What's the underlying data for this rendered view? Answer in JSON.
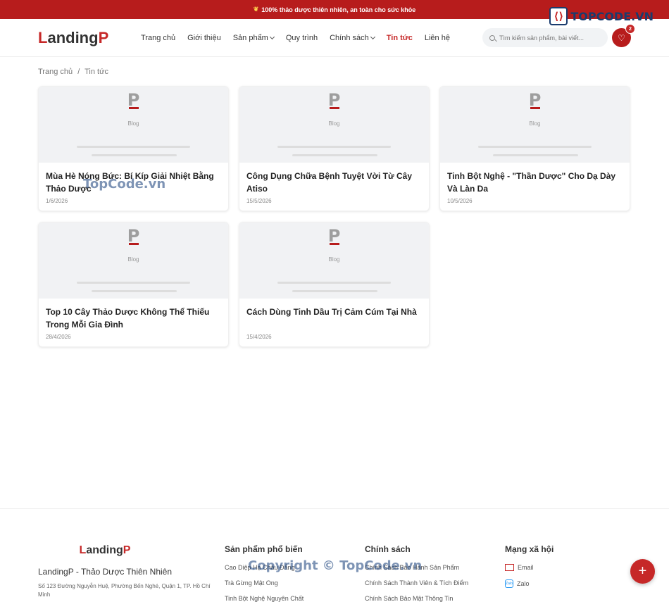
{
  "topbar": {
    "announcement": "100% thảo dược thiên nhiên, an toàn cho sức khỏe"
  },
  "watermark": {
    "logo_text": "TOPCODE.VN",
    "mid_text": "TopCode.vn",
    "footer_text": "Copyright © TopCode.vn"
  },
  "header": {
    "logo_first": "L",
    "logo_rest": "anding",
    "logo_last": "P",
    "nav": [
      {
        "label": "Trang chủ",
        "dropdown": false,
        "active": false
      },
      {
        "label": "Giới thiệu",
        "dropdown": false,
        "active": false
      },
      {
        "label": "Sản phẩm",
        "dropdown": true,
        "active": false
      },
      {
        "label": "Quy trình",
        "dropdown": false,
        "active": false
      },
      {
        "label": "Chính sách",
        "dropdown": true,
        "active": false
      },
      {
        "label": "Tin tức",
        "dropdown": false,
        "active": true
      },
      {
        "label": "Liên hệ",
        "dropdown": false,
        "active": false
      }
    ],
    "search_placeholder": "Tìm kiếm sản phẩm, bài viết...",
    "cart_count": "2"
  },
  "breadcrumb": {
    "home": "Trang chủ",
    "sep": "/",
    "current": "Tin tức"
  },
  "posts": [
    {
      "thumb_label": "Blog",
      "title": "Mùa Hè Nóng Bức: Bí Kíp Giải Nhiệt Bằng Thảo Dược",
      "date": "1/6/2026"
    },
    {
      "thumb_label": "Blog",
      "title": "Công Dụng Chữa Bệnh Tuyệt Vời Từ Cây Atiso",
      "date": "15/5/2026"
    },
    {
      "thumb_label": "Blog",
      "title": "Tinh Bột Nghệ - \"Thần Dược\" Cho Dạ Dày Và Làn Da",
      "date": "10/5/2026"
    },
    {
      "thumb_label": "Blog",
      "title": "Top 10 Cây Thảo Dược Không Thể Thiếu Trong Mỗi Gia Đình",
      "date": "28/4/2026"
    },
    {
      "thumb_label": "Blog",
      "title": "Cách Dùng Tinh Dầu Trị Cảm Cúm Tại Nhà",
      "date": "15/4/2026"
    }
  ],
  "footer": {
    "logo_first": "L",
    "logo_rest": "anding",
    "logo_last": "P",
    "brand": "LandingP - Thảo Dược Thiên Nhiên",
    "address": "Số 123 Đường Nguyễn Huệ, Phường Bến Nghé, Quận 1, TP. Hồ Chí Minh",
    "products_heading": "Sản phẩm phổ biến",
    "products": [
      "Cao Diệp Hạ Châu Đắng",
      "Trà Gừng Mật Ong",
      "Tinh Bột Nghệ Nguyên Chất"
    ],
    "policy_heading": "Chính sách",
    "policies": [
      "Chính Sách Bảo Hành Sản Phẩm",
      "Chính Sách Thành Viên & Tích Điểm",
      "Chính Sách Bảo Mật Thông Tin"
    ],
    "social_heading": "Mạng xã hội",
    "socials": [
      {
        "label": "Email",
        "icon": "gmail-icon"
      },
      {
        "label": "Zalo",
        "icon": "zalo-icon"
      }
    ]
  },
  "fab": {
    "icon": "plus-icon",
    "label": "+"
  }
}
